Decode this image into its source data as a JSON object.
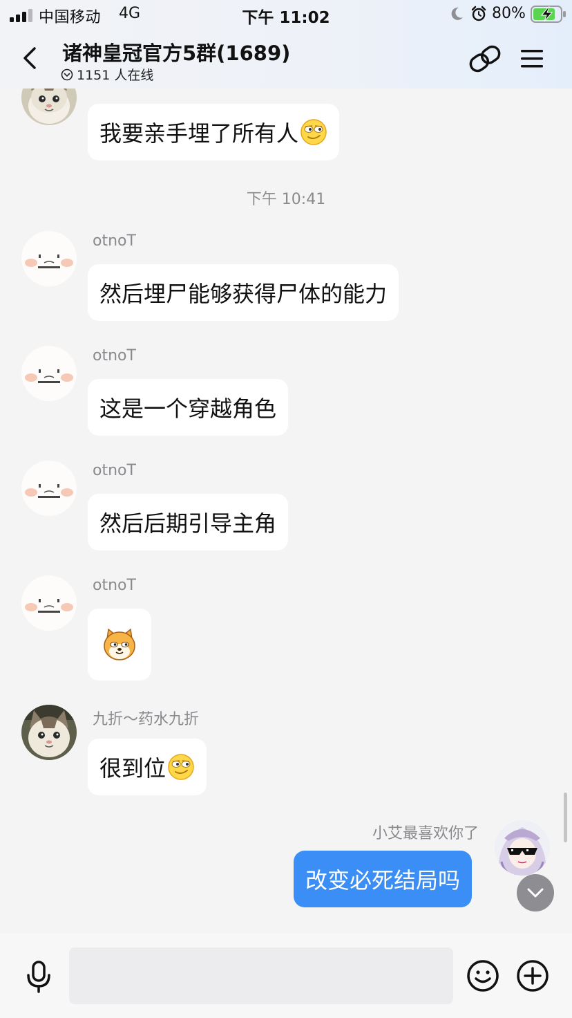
{
  "status_bar": {
    "carrier": "中国移动",
    "network": "4G",
    "time": "下午 11:02",
    "battery_percent": "80%",
    "signal_bars": 3,
    "icons": [
      "moon-icon",
      "alarm-icon",
      "battery-charging-icon"
    ]
  },
  "header": {
    "title": "诸神皇冠官方5群(1689)",
    "online_text": "1151 人在线",
    "icons": [
      "back-icon",
      "online-status-icon",
      "link-icon",
      "menu-icon"
    ]
  },
  "chat": {
    "timestamp": "下午 10:41",
    "messages": [
      {
        "sender": "",
        "text": "我要亲手埋了所有人",
        "emoji": "smirk-emoji",
        "avatar": "cat-avatar"
      },
      {
        "sender": "otnoT",
        "text": "然后埋尸能够获得尸体的能力",
        "avatar": "blush-face-avatar"
      },
      {
        "sender": "otnoT",
        "text": "这是一个穿越角色",
        "avatar": "blush-face-avatar"
      },
      {
        "sender": "otnoT",
        "text": "然后后期引导主角",
        "avatar": "blush-face-avatar"
      },
      {
        "sender": "otnoT",
        "text": "",
        "sticker": "shiba-emoji",
        "avatar": "blush-face-avatar"
      },
      {
        "sender": "九折～药水九折",
        "text": "很到位",
        "emoji": "smirk-emoji",
        "avatar": "cat-avatar"
      },
      {
        "sender": "小艾最喜欢你了",
        "text": "改变必死结局吗",
        "avatar": "anime-girl-sunglasses-avatar",
        "mine": true
      }
    ]
  },
  "input_bar": {
    "placeholder": "",
    "icons": [
      "microphone-icon",
      "emoji-face-icon",
      "plus-circle-icon"
    ]
  },
  "colors": {
    "background": "#f4f4f5",
    "bubble_other": "#ffffff",
    "bubble_mine": "#3a8ef5",
    "secondary_text": "#8a8a8e"
  }
}
